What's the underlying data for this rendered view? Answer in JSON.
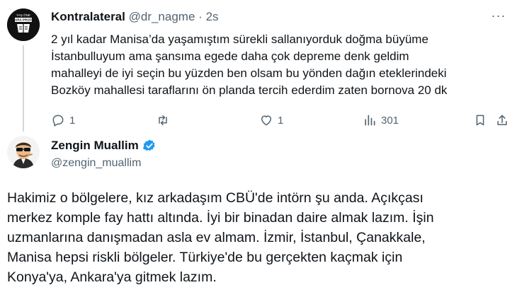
{
  "reply_tweet": {
    "avatar_text": "KARA PROFIL",
    "display_name": "Kontralateral",
    "handle": "@dr_nagme",
    "separator": "·",
    "time": "2s",
    "more_label": "···",
    "text_lines": [
      "2 yıl kadar Manisa’da yaşamıştım sürekli sallanıyorduk doğma büyüme",
      "İstanbulluyum ama şansıma egede daha çok depreme denk geldim",
      "mahalleyi de iyi seçin bu yüzden ben olsam bu yönden dağın eteklerindeki",
      "Bozköy mahallesi taraflarını ön planda tercih ederdim zaten bornova 20 dk"
    ],
    "actions": {
      "replies": "1",
      "retweets": "",
      "likes": "1",
      "views": "301"
    }
  },
  "main_tweet": {
    "display_name": "Zengin Muallim",
    "handle": "@zengin_muallim",
    "verified": true,
    "accent_color": "#1d9bf0",
    "text_lines": [
      "Hakimiz o bölgelere, kız arkadaşım CBÜ'de intörn şu anda. Açıkçası",
      "merkez komple fay hattı altında. İyi bir binadan daire almak lazım. İşin",
      "uzmanlarına danışmadan asla ev almam. İzmir, İstanbul, Çanakkale,",
      "Manisa hepsi riskli bölgeler. Türkiye'de bu gerçekten kaçmak için",
      "Konya'ya, Ankara'ya gitmek lazım."
    ]
  },
  "colors": {
    "text": "#0f1419",
    "secondary": "#536471",
    "thread_line": "#cfd9de"
  }
}
